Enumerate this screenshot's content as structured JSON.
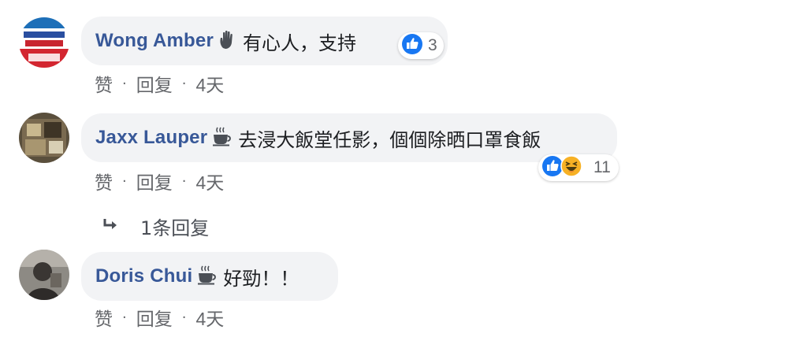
{
  "comments": [
    {
      "author": "Wong Amber",
      "text": "有心人，支持",
      "reactions": {
        "icons": [
          "like-icon"
        ],
        "count": "3"
      },
      "actions": {
        "like": "赞",
        "reply": "回复",
        "time": "4天"
      },
      "badge_icon": "hand-wave-icon"
    },
    {
      "author": "Jaxx Lauper",
      "text": "去浸大飯堂任影，個個除晒口罩食飯",
      "reactions": {
        "icons": [
          "like-icon",
          "haha-icon"
        ],
        "count": "11"
      },
      "actions": {
        "like": "赞",
        "reply": "回复",
        "time": "4天"
      },
      "badge_icon": "coffee-icon",
      "replies_label": "1条回复"
    },
    {
      "author": "Doris Chui",
      "text": "好勁！！",
      "actions": {
        "like": "赞",
        "reply": "回复",
        "time": "4天"
      },
      "badge_icon": "coffee-icon"
    }
  ],
  "colors": {
    "author": "#385898",
    "bubble": "#f2f3f5",
    "meta": "#65676b",
    "like_blue": "#1877f2",
    "haha_yellow": "#f7b125"
  }
}
